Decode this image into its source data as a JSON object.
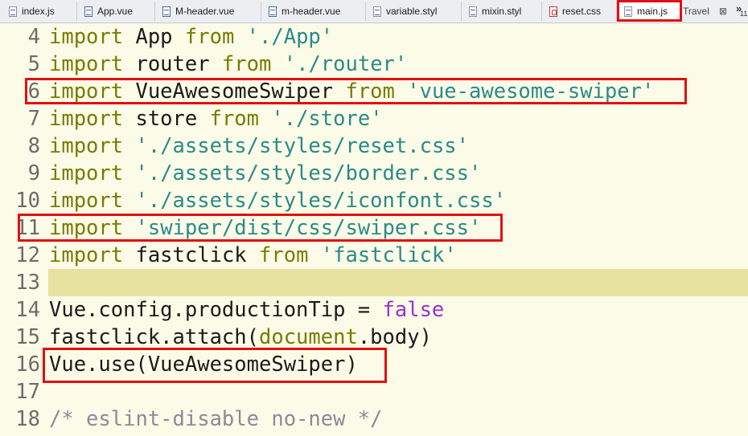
{
  "tabs": [
    {
      "label": "index.js",
      "icon": "js-file-icon"
    },
    {
      "label": "App.vue",
      "icon": "vue-file-icon"
    },
    {
      "label": "M-header.vue",
      "icon": "vue-file-icon"
    },
    {
      "label": "m-header.vue",
      "icon": "vue-file-icon"
    },
    {
      "label": "variable.styl",
      "icon": "styl-file-icon"
    },
    {
      "label": "mixin.styl",
      "icon": "styl-file-icon"
    },
    {
      "label": "reset.css",
      "icon": "css-file-icon"
    },
    {
      "label": "main.js",
      "icon": "js-file-icon",
      "active": true
    }
  ],
  "project_label": "Travel",
  "close_glyph": "⊠",
  "overflow": {
    "glyph": "»",
    "count": "11"
  },
  "lines": [
    {
      "num": "4",
      "tokens": [
        {
          "t": "import",
          "c": "kw"
        },
        {
          "t": " App "
        },
        {
          "t": "from",
          "c": "kw"
        },
        {
          "t": " "
        },
        {
          "t": "'./App'",
          "c": "str"
        }
      ]
    },
    {
      "num": "5",
      "tokens": [
        {
          "t": "import",
          "c": "kw"
        },
        {
          "t": " router "
        },
        {
          "t": "from",
          "c": "kw"
        },
        {
          "t": " "
        },
        {
          "t": "'./router'",
          "c": "str"
        }
      ]
    },
    {
      "num": "6",
      "tokens": [
        {
          "t": "import",
          "c": "kw"
        },
        {
          "t": " VueAwesomeSwiper "
        },
        {
          "t": "from",
          "c": "kw"
        },
        {
          "t": " "
        },
        {
          "t": "'vue-awesome-swiper'",
          "c": "str"
        }
      ]
    },
    {
      "num": "7",
      "tokens": [
        {
          "t": "import",
          "c": "kw"
        },
        {
          "t": " store "
        },
        {
          "t": "from",
          "c": "kw"
        },
        {
          "t": " "
        },
        {
          "t": "'./store'",
          "c": "str"
        }
      ]
    },
    {
      "num": "8",
      "tokens": [
        {
          "t": "import",
          "c": "kw"
        },
        {
          "t": " "
        },
        {
          "t": "'./assets/styles/reset.css'",
          "c": "str"
        }
      ]
    },
    {
      "num": "9",
      "tokens": [
        {
          "t": "import",
          "c": "kw"
        },
        {
          "t": " "
        },
        {
          "t": "'./assets/styles/border.css'",
          "c": "str"
        }
      ]
    },
    {
      "num": "10",
      "tokens": [
        {
          "t": "import",
          "c": "kw"
        },
        {
          "t": " "
        },
        {
          "t": "'./assets/styles/iconfont.css'",
          "c": "str"
        }
      ]
    },
    {
      "num": "11",
      "tokens": [
        {
          "t": "import",
          "c": "kw"
        },
        {
          "t": " "
        },
        {
          "t": "'swiper/dist/css/swiper.css'",
          "c": "str"
        }
      ]
    },
    {
      "num": "12",
      "tokens": [
        {
          "t": "import",
          "c": "kw"
        },
        {
          "t": " fastclick "
        },
        {
          "t": "from",
          "c": "kw"
        },
        {
          "t": " "
        },
        {
          "t": "'fastclick'",
          "c": "str"
        }
      ]
    },
    {
      "num": "13",
      "tokens": [],
      "current": true
    },
    {
      "num": "14",
      "tokens": [
        {
          "t": "Vue.config.productionTip = "
        },
        {
          "t": "false",
          "c": "bool"
        }
      ]
    },
    {
      "num": "15",
      "tokens": [
        {
          "t": "fastclick.attach("
        },
        {
          "t": "document",
          "c": "kw"
        },
        {
          "t": ".body)"
        }
      ]
    },
    {
      "num": "16",
      "tokens": [
        {
          "t": "Vue.use(VueAwesomeSwiper)"
        }
      ]
    },
    {
      "num": "17",
      "tokens": []
    },
    {
      "num": "18",
      "tokens": [
        {
          "t": "/* eslint-disable no-new */",
          "c": "cmt"
        }
      ]
    }
  ],
  "colors": {
    "background": "#fbfbe7",
    "current_line": "#e8e2a1",
    "keyword": "#7a7a00",
    "string": "#2a8a8a",
    "boolean": "#9a33cc",
    "comment": "#8a8a9a",
    "highlight_box": "#e01010"
  }
}
